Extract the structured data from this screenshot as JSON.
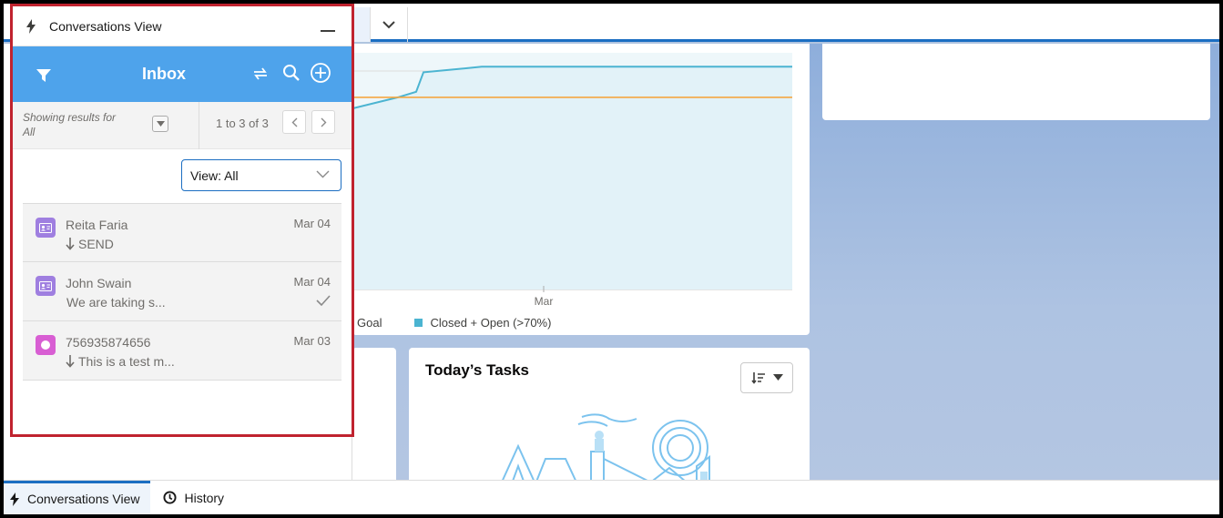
{
  "panel": {
    "title": "Conversations View",
    "inbox_title": "Inbox",
    "showing_results": "Showing results for",
    "showing_filter": "All",
    "count_text": "1 to 3 of 3",
    "view_select": "View: All",
    "conversations": [
      {
        "name": "Reita Faria",
        "date": "Mar 04",
        "message": "SEND",
        "direction": "in",
        "avatar_color": "#9f7fe0",
        "avatar_icon": "contact-card-icon"
      },
      {
        "name": "John Swain",
        "date": "Mar 04",
        "message": "We are taking s...",
        "direction": "none",
        "avatar_color": "#9f7fe0",
        "avatar_icon": "contact-card-icon",
        "delivered": true
      },
      {
        "name": "756935874656",
        "date": "Mar 03",
        "message": "This is a test m...",
        "direction": "in",
        "avatar_color": "#d85ed3",
        "avatar_icon": "circle-icon"
      }
    ]
  },
  "chart": {
    "x_tick": "Mar",
    "legend": [
      {
        "label": "Goal",
        "color": "#f5a742"
      },
      {
        "label": "Closed + Open (>70%)",
        "color": "#4bb4d1"
      }
    ]
  },
  "chart_data": {
    "type": "line",
    "series": [
      {
        "name": "Goal",
        "values": [
          0.69,
          0.69
        ]
      },
      {
        "name": "Closed + Open (>70%)",
        "values": [
          0.65,
          0.69,
          0.71,
          0.78,
          0.79,
          0.8,
          0.8,
          0.8
        ]
      }
    ]
  },
  "tasks": {
    "title": "Today’s Tasks"
  },
  "utility_bar": {
    "tabs": [
      {
        "label": "Conversations View",
        "icon": "lightning-icon",
        "active": true
      },
      {
        "label": "History",
        "icon": "clock-icon",
        "active": false
      }
    ]
  },
  "colors": {
    "brand": "#1b6ec2",
    "inbox_bar": "#4ea3eb",
    "highlight_border": "#c0232f"
  }
}
